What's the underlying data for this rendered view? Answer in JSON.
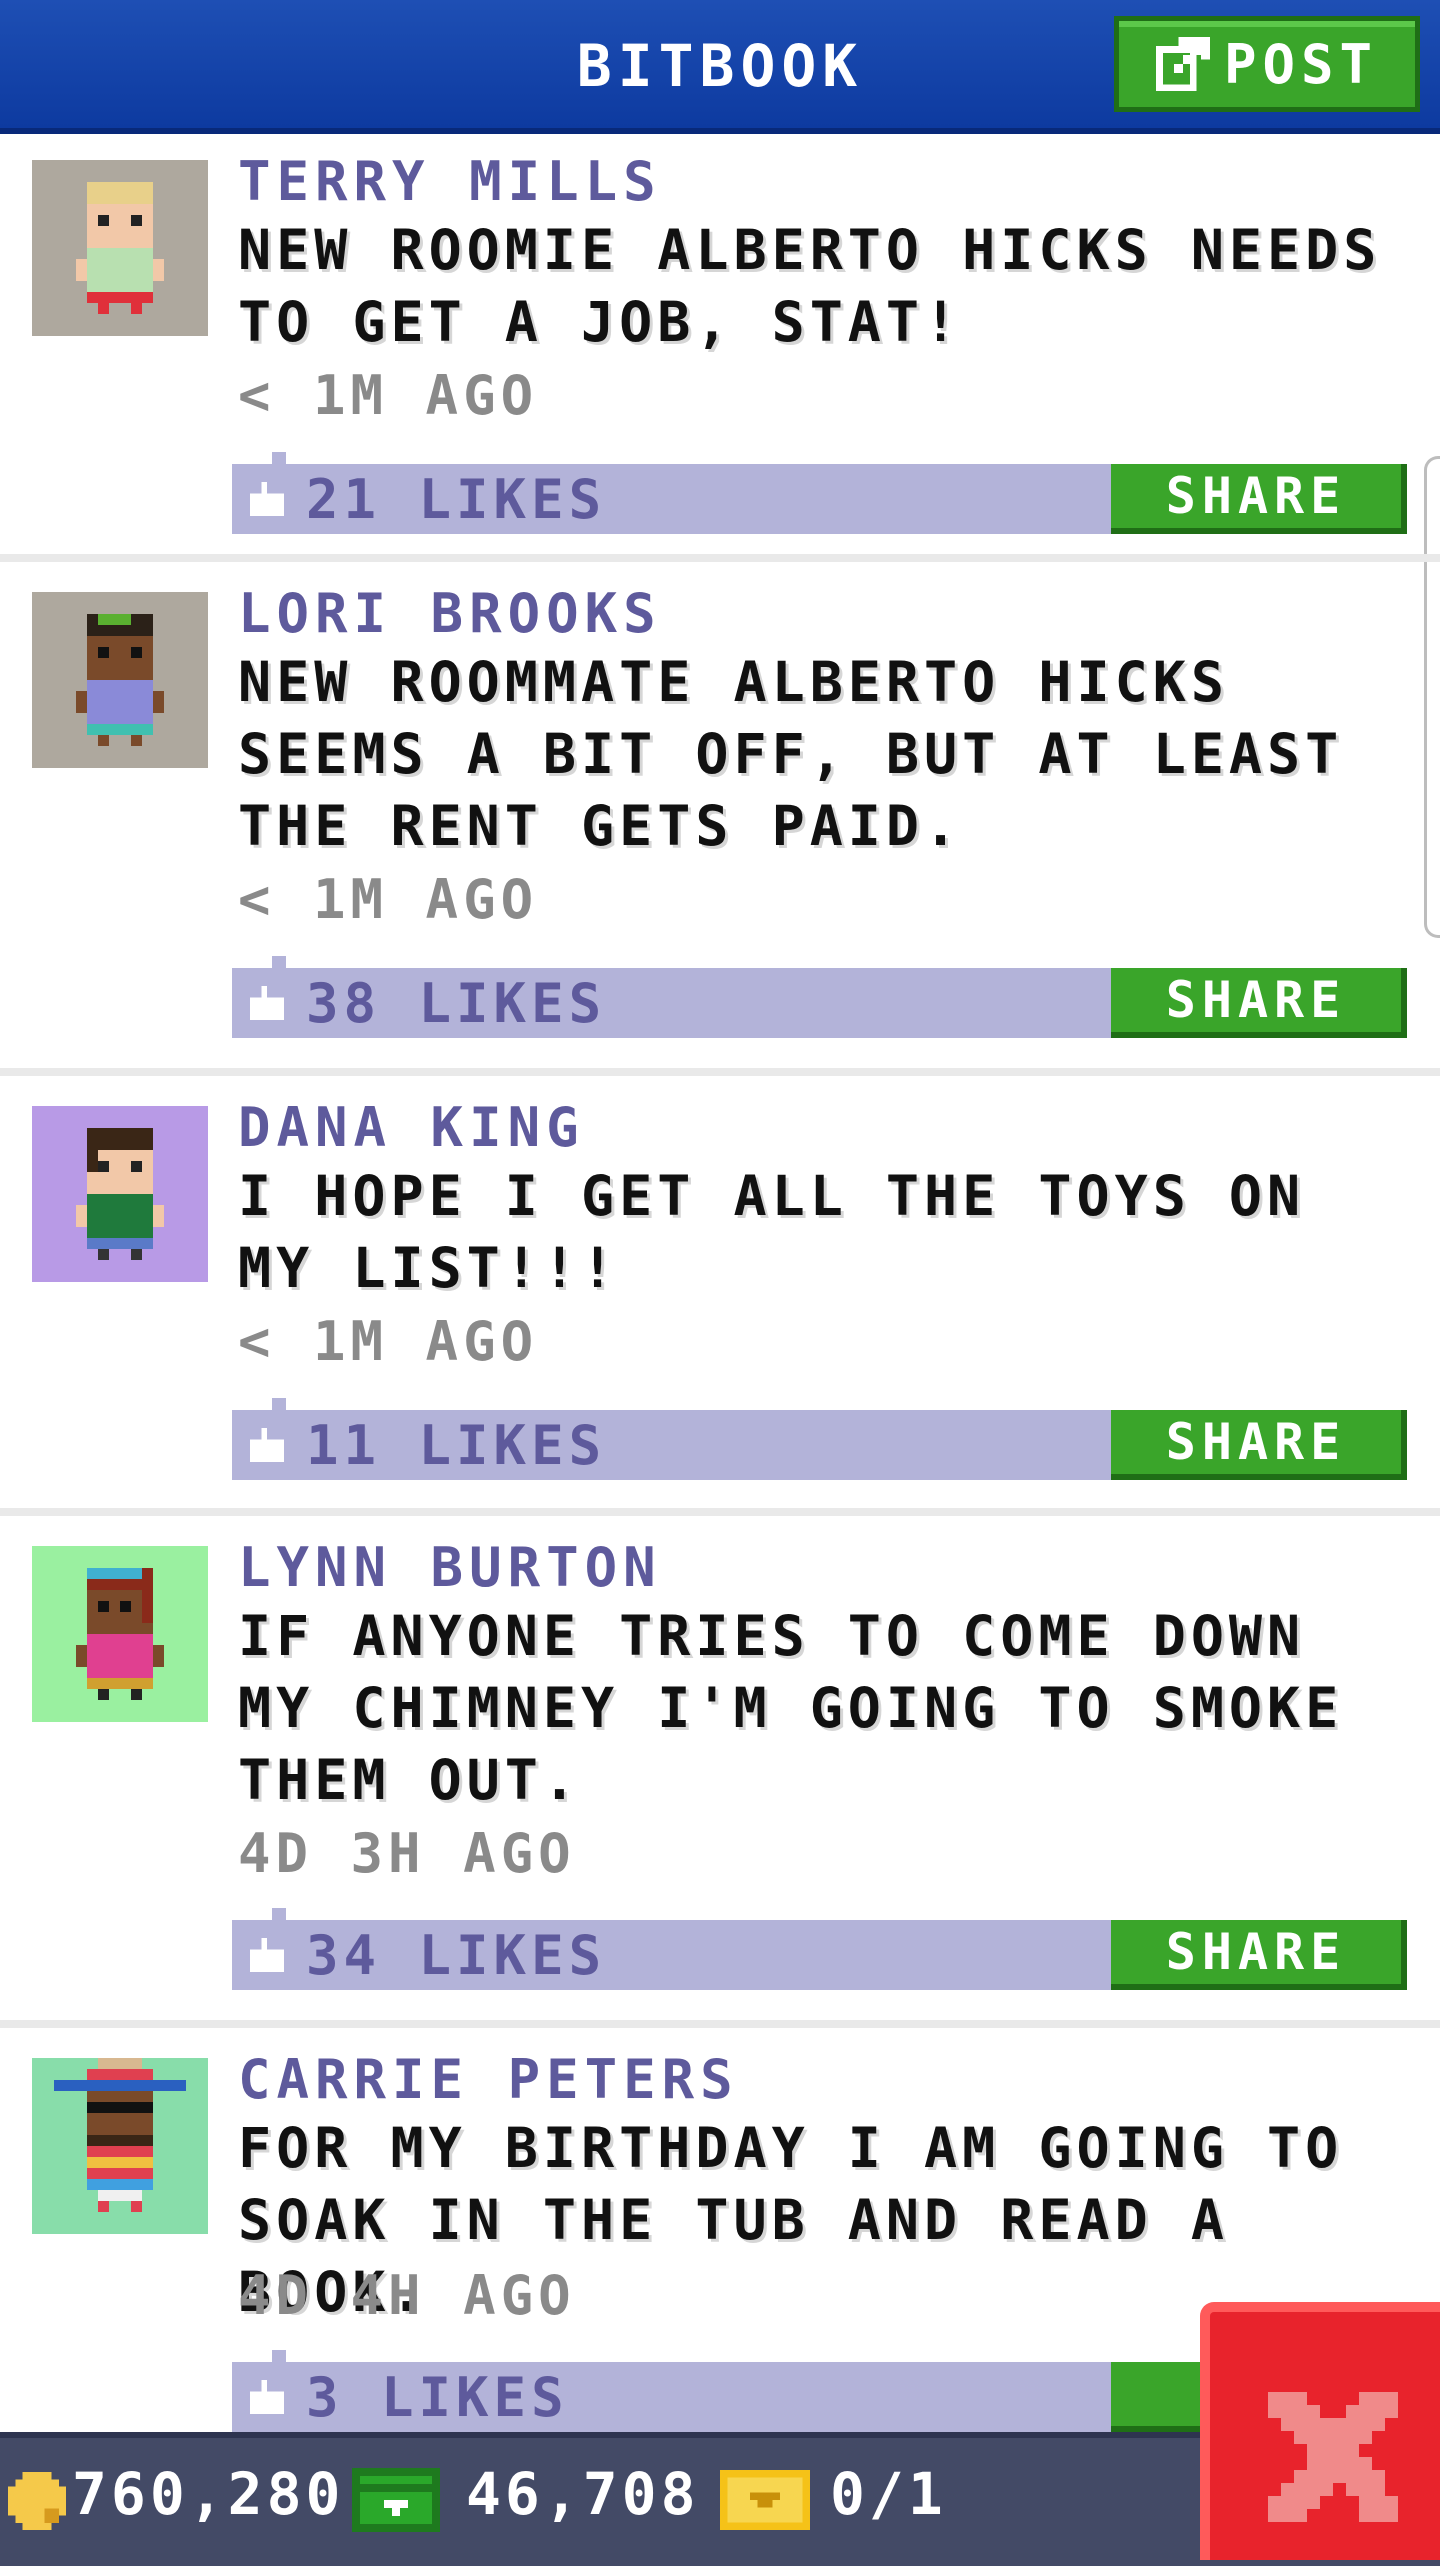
{
  "header": {
    "title": "BITBOOK",
    "post_label": "POST"
  },
  "posts": [
    {
      "name": "TERRY MILLS",
      "text": "NEW ROOMIE ALBERTO HICKS NEEDS TO GET A JOB, STAT!",
      "time": "< 1M AGO",
      "likes": "21 LIKES",
      "share": "SHARE"
    },
    {
      "name": "LORI BROOKS",
      "text": "NEW ROOMMATE ALBERTO HICKS SEEMS A BIT OFF, BUT AT LEAST THE RENT GETS PAID.",
      "time": "< 1M AGO",
      "likes": "38 LIKES",
      "share": "SHARE"
    },
    {
      "name": "DANA KING",
      "text": "I HOPE I GET ALL THE TOYS ON MY LIST!!!",
      "time": "< 1M AGO",
      "likes": "11 LIKES",
      "share": "SHARE"
    },
    {
      "name": "LYNN BURTON",
      "text": "IF ANYONE TRIES TO COME DOWN MY CHIMNEY I'M GOING TO SMOKE THEM OUT.",
      "time": "4D 3H AGO",
      "likes": "34 LIKES",
      "share": "SHARE"
    },
    {
      "name": "CARRIE PETERS",
      "text": "FOR MY BIRTHDAY I AM GOING TO SOAK IN THE TUB AND READ A BOOK.",
      "time": "4D 4H AGO",
      "likes": "3 LIKES",
      "share": "S"
    }
  ],
  "status": {
    "coins": "760,280",
    "bux": "46,708",
    "tickets": "0/1"
  },
  "colors": {
    "header": "#1e4fb4",
    "accent_green": "#3aa52a",
    "name_purple": "#5e5a9c",
    "like_bar": "#b3b3d9",
    "close_red": "#e8232c"
  },
  "icons": [
    "post-edit-icon",
    "thumb-up-icon",
    "coin-icon",
    "bux-icon",
    "ticket-icon",
    "close-icon"
  ]
}
